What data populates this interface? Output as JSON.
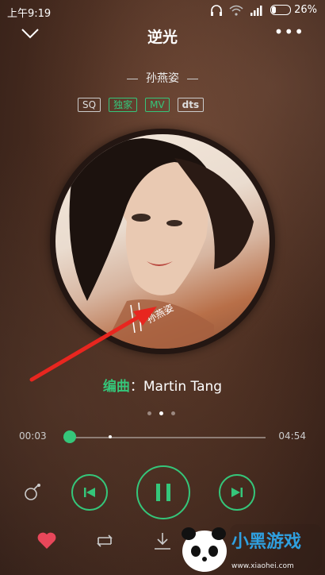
{
  "status_bar": {
    "time": "上午9:19",
    "battery": "26%",
    "battery_level": 0.26
  },
  "header": {
    "title": "逆光",
    "back_icon": "chevron-down-icon",
    "more_icon": "more-dots-icon"
  },
  "artist": "孙燕姿",
  "badges": [
    "SQ",
    "独家",
    "MV",
    "dts"
  ],
  "album_art_text": "孙燕姿",
  "composer": {
    "label": "编曲",
    "separator": "：",
    "name": "Martin Tang"
  },
  "progress": {
    "current": "00:03",
    "total": "04:54",
    "fraction": 0.03
  },
  "controls": {
    "mode_icon": "play-mode-icon",
    "prev_icon": "previous-icon",
    "play_icon": "pause-icon",
    "next_icon": "next-icon"
  },
  "bottom_bar": {
    "like_icon": "heart-icon",
    "repeat_icon": "repeat-icon",
    "download_icon": "download-icon"
  },
  "watermark": {
    "text": "小黑游戏",
    "url": "www.xiaohei.com"
  },
  "colors": {
    "accent": "#35c67a",
    "background": "#4a2d20"
  }
}
